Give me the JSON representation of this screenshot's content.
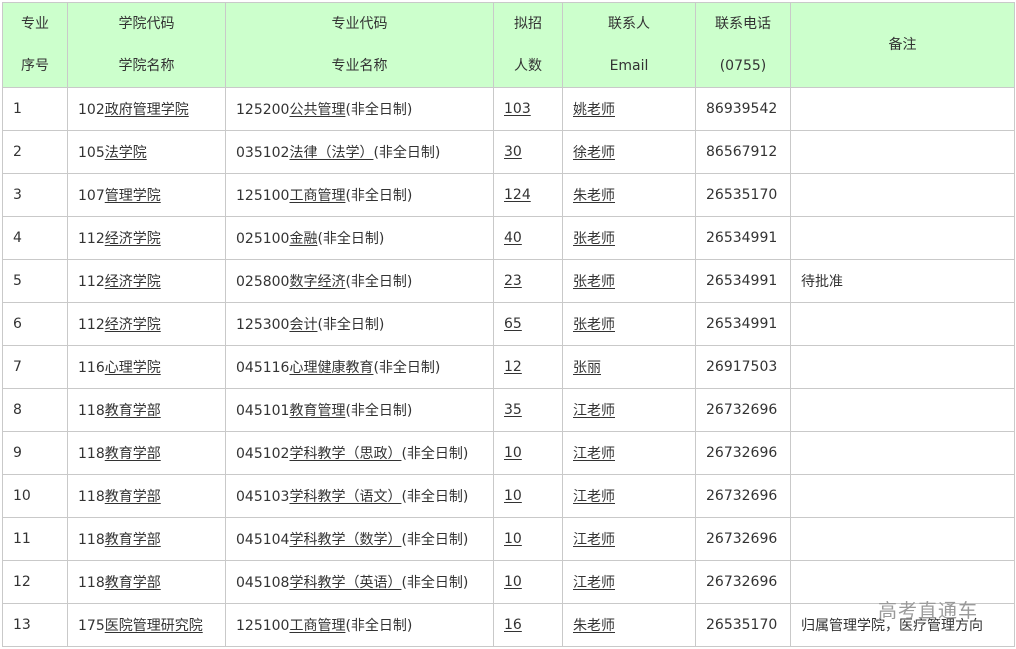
{
  "header": {
    "seq": [
      "专业",
      "序号"
    ],
    "college": [
      "学院代码",
      "学院名称"
    ],
    "major": [
      "专业代码",
      "专业名称"
    ],
    "quota": [
      "拟招",
      "人数"
    ],
    "contact": [
      "联系人",
      "Email"
    ],
    "phone": [
      "联系电话",
      "(0755)"
    ],
    "note": "备注"
  },
  "rows": [
    {
      "seq": "1",
      "college_code": "102",
      "college_name": "政府管理学院",
      "major_code": "125200",
      "major_name": "公共管理",
      "mode": "(非全日制)",
      "quota": "103",
      "contact": "姚老师",
      "phone": "86939542",
      "note": ""
    },
    {
      "seq": "2",
      "college_code": "105",
      "college_name": "法学院",
      "major_code": "035102",
      "major_name": "法律（法学）",
      "mode": "(非全日制)",
      "quota": "30",
      "contact": "徐老师",
      "phone": "86567912",
      "note": ""
    },
    {
      "seq": "3",
      "college_code": "107",
      "college_name": "管理学院",
      "major_code": "125100",
      "major_name": "工商管理",
      "mode": "(非全日制)",
      "quota": "124",
      "contact": "朱老师",
      "phone": "26535170",
      "note": ""
    },
    {
      "seq": "4",
      "college_code": "112",
      "college_name": "经济学院",
      "major_code": "025100",
      "major_name": "金融",
      "mode": "(非全日制)",
      "quota": "40",
      "contact": "张老师",
      "phone": "26534991",
      "note": ""
    },
    {
      "seq": "5",
      "college_code": "112",
      "college_name": "经济学院",
      "major_code": "025800",
      "major_name": "数字经济",
      "mode": "(非全日制)",
      "quota": "23",
      "contact": "张老师",
      "phone": "26534991",
      "note": "待批准"
    },
    {
      "seq": "6",
      "college_code": "112",
      "college_name": "经济学院",
      "major_code": "125300",
      "major_name": "会计",
      "mode": "(非全日制)",
      "quota": "65",
      "contact": "张老师",
      "phone": "26534991",
      "note": ""
    },
    {
      "seq": "7",
      "college_code": "116",
      "college_name": "心理学院",
      "major_code": "045116",
      "major_name": "心理健康教育",
      "mode": "(非全日制)",
      "quota": "12",
      "contact": "张丽",
      "phone": "26917503",
      "note": ""
    },
    {
      "seq": "8",
      "college_code": "118",
      "college_name": "教育学部",
      "major_code": "045101",
      "major_name": "教育管理",
      "mode": "(非全日制)",
      "quota": "35",
      "contact": "江老师",
      "phone": "26732696",
      "note": ""
    },
    {
      "seq": "9",
      "college_code": "118",
      "college_name": "教育学部",
      "major_code": "045102",
      "major_name": "学科教学（思政）",
      "mode": "(非全日制)",
      "quota": "10",
      "contact": "江老师",
      "phone": "26732696",
      "note": ""
    },
    {
      "seq": "10",
      "college_code": "118",
      "college_name": "教育学部",
      "major_code": "045103",
      "major_name": "学科教学（语文）",
      "mode": "(非全日制)",
      "quota": "10",
      "contact": "江老师",
      "phone": "26732696",
      "note": ""
    },
    {
      "seq": "11",
      "college_code": "118",
      "college_name": "教育学部",
      "major_code": "045104",
      "major_name": "学科教学（数学）",
      "mode": "(非全日制)",
      "quota": "10",
      "contact": "江老师",
      "phone": "26732696",
      "note": ""
    },
    {
      "seq": "12",
      "college_code": "118",
      "college_name": "教育学部",
      "major_code": "045108",
      "major_name": "学科教学（英语）",
      "mode": "(非全日制)",
      "quota": "10",
      "contact": "江老师",
      "phone": "26732696",
      "note": ""
    },
    {
      "seq": "13",
      "college_code": "175",
      "college_name": "医院管理研究院",
      "major_code": "125100",
      "major_name": "工商管理",
      "mode": "(非全日制)",
      "quota": "16",
      "contact": "朱老师",
      "phone": "26535170",
      "note": "归属管理学院，医疗管理方向"
    }
  ],
  "watermark": "高考直通车",
  "colors": {
    "header_bg": "#ccffcc",
    "border": "#c9c9c9",
    "text": "#333333"
  }
}
